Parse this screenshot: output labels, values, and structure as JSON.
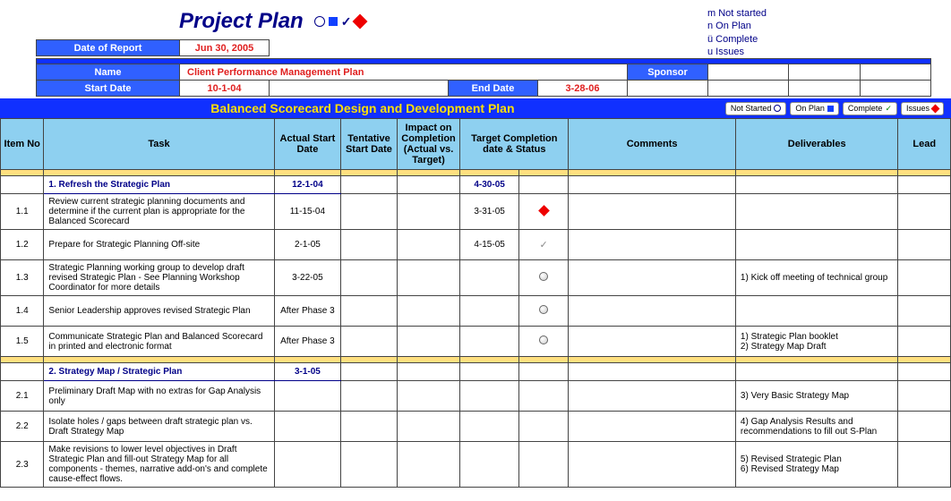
{
  "legend": {
    "l1": "m Not started",
    "l2": "n On Plan",
    "l3": "ü Complete",
    "l4": "u Issues"
  },
  "title": "Project Plan",
  "meta": {
    "date_report_lbl": "Date of Report",
    "date_report": "Jun 30, 2005",
    "name_lbl": "Name",
    "name": "Client Performance Management Plan",
    "sponsor_lbl": "Sponsor",
    "start_lbl": "Start Date",
    "start": "10-1-04",
    "end_lbl": "End Date",
    "end": "3-28-06"
  },
  "section_title": "Balanced Scorecard Design and Development Plan",
  "filters": {
    "f1": "Not Started",
    "f2": "On Plan",
    "f3": "Complete",
    "f4": "Issues"
  },
  "headers": {
    "item": "Item No",
    "task": "Task",
    "actual": "Actual Start Date",
    "tentative": "Tentative Start Date",
    "impact": "Impact on Completion (Actual vs. Target)",
    "target": "Target Completion date & Status",
    "comments": "Comments",
    "deliverables": "Deliverables",
    "lead": "Lead"
  },
  "sections": [
    {
      "title": "1. Refresh the Strategic Plan",
      "start": "12-1-04",
      "target": "4-30-05"
    },
    {
      "title": "2. Strategy Map / Strategic Plan",
      "start": "3-1-05",
      "target": ""
    }
  ],
  "rows": [
    {
      "no": "1.1",
      "task": "Review current strategic planning documents and determine if the current plan is appropriate for the Balanced Scorecard",
      "actual": "11-15-04",
      "target": "3-31-05",
      "status": "diam",
      "dlv": ""
    },
    {
      "no": "1.2",
      "task": "Prepare for Strategic Planning Off-site",
      "actual": "2-1-05",
      "target": "4-15-05",
      "status": "chk",
      "dlv": ""
    },
    {
      "no": "1.3",
      "task": "Strategic Planning working group to develop draft revised Strategic Plan - See Planning Workshop Coordinator for more details",
      "actual": "3-22-05",
      "target": "",
      "status": "circ",
      "dlv": "1) Kick off meeting of technical group"
    },
    {
      "no": "1.4",
      "task": "Senior Leadership approves revised Strategic Plan",
      "actual": "After Phase 3",
      "target": "",
      "status": "circ",
      "dlv": ""
    },
    {
      "no": "1.5",
      "task": "Communicate Strategic Plan and Balanced Scorecard in printed and electronic format",
      "actual": "After Phase 3",
      "target": "",
      "status": "circ",
      "dlv": "1) Strategic Plan booklet\n2) Strategy Map Draft"
    },
    {
      "no": "2.1",
      "task": "Preliminary Draft Map with no extras for Gap Analysis only",
      "actual": "",
      "target": "",
      "status": "",
      "dlv": "3) Very Basic Strategy Map"
    },
    {
      "no": "2.2",
      "task": "Isolate holes / gaps between draft strategic plan vs. Draft Strategy Map",
      "actual": "",
      "target": "",
      "status": "",
      "dlv": "4) Gap Analysis Results and recommendations to fill out S-Plan"
    },
    {
      "no": "2.3",
      "task": "Make revisions to lower level objectives in Draft Strategic Plan and fill-out Strategy Map for all components - themes, narrative add-on's and complete cause-effect flows.",
      "actual": "",
      "target": "",
      "status": "",
      "dlv": "5) Revised Strategic Plan\n6) Revised Strategy Map"
    }
  ]
}
